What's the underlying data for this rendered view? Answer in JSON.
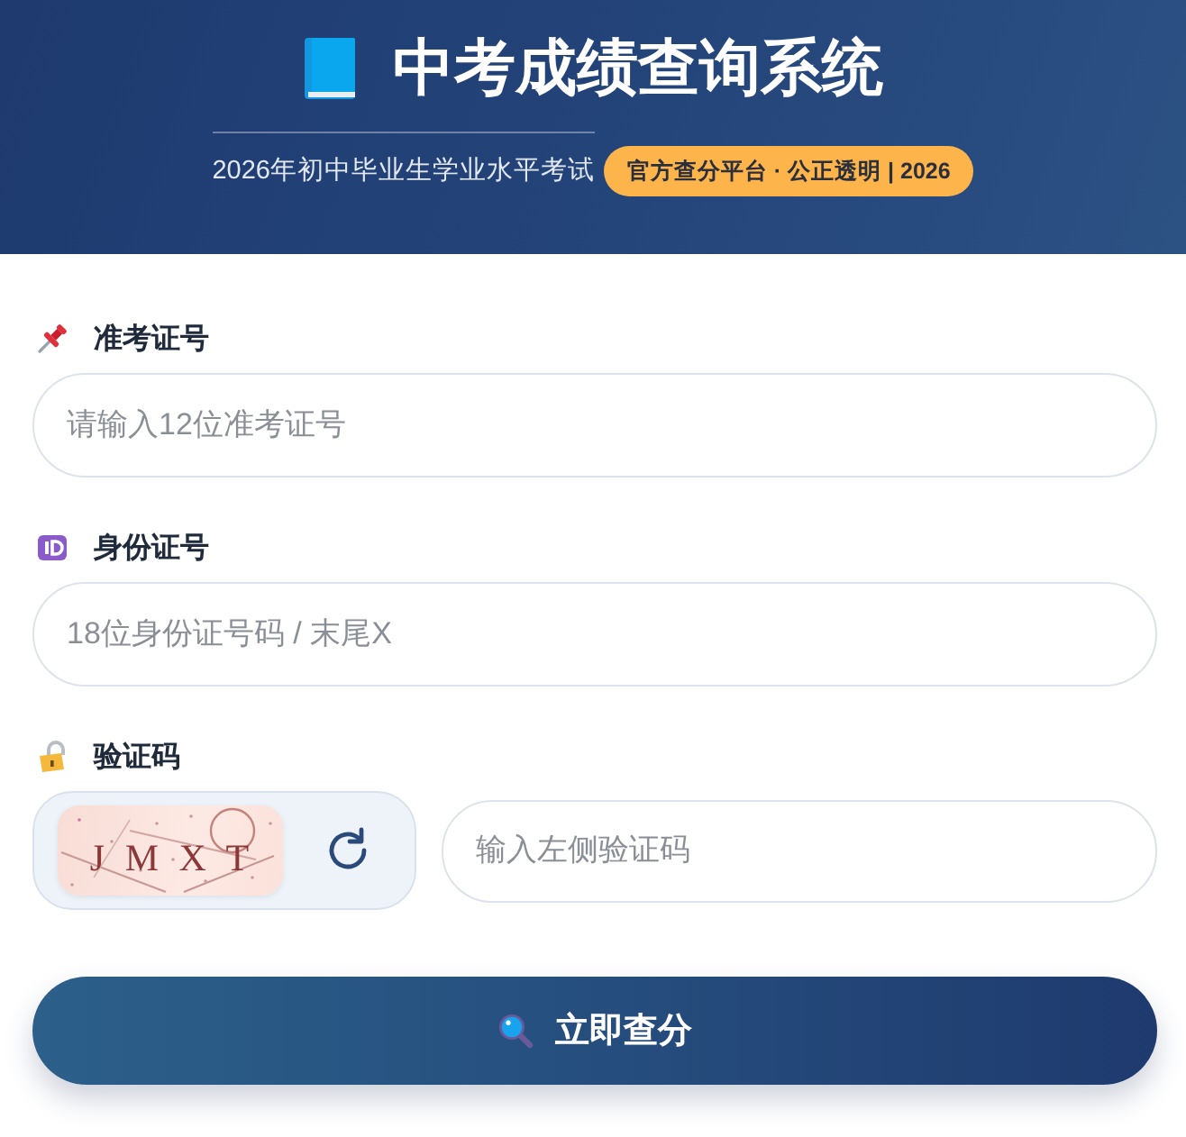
{
  "header": {
    "title": "中考成绩查询系统",
    "subtitle": "2026年初中毕业生学业水平考试",
    "badge": "官方查分平台 · 公正透明 | 2026"
  },
  "fields": [
    {
      "kind": "text",
      "label": "准考证号",
      "placeholder": "请输入12位准考证号"
    },
    {
      "kind": "text",
      "label": "身份证号",
      "placeholder": "18位身份证号码 / 末尾X"
    },
    {
      "kind": "captcha",
      "label": "验证码",
      "captcha_text": "J M X T",
      "placeholder": "输入左侧验证码"
    }
  ],
  "submit": {
    "label": "立即查分"
  }
}
